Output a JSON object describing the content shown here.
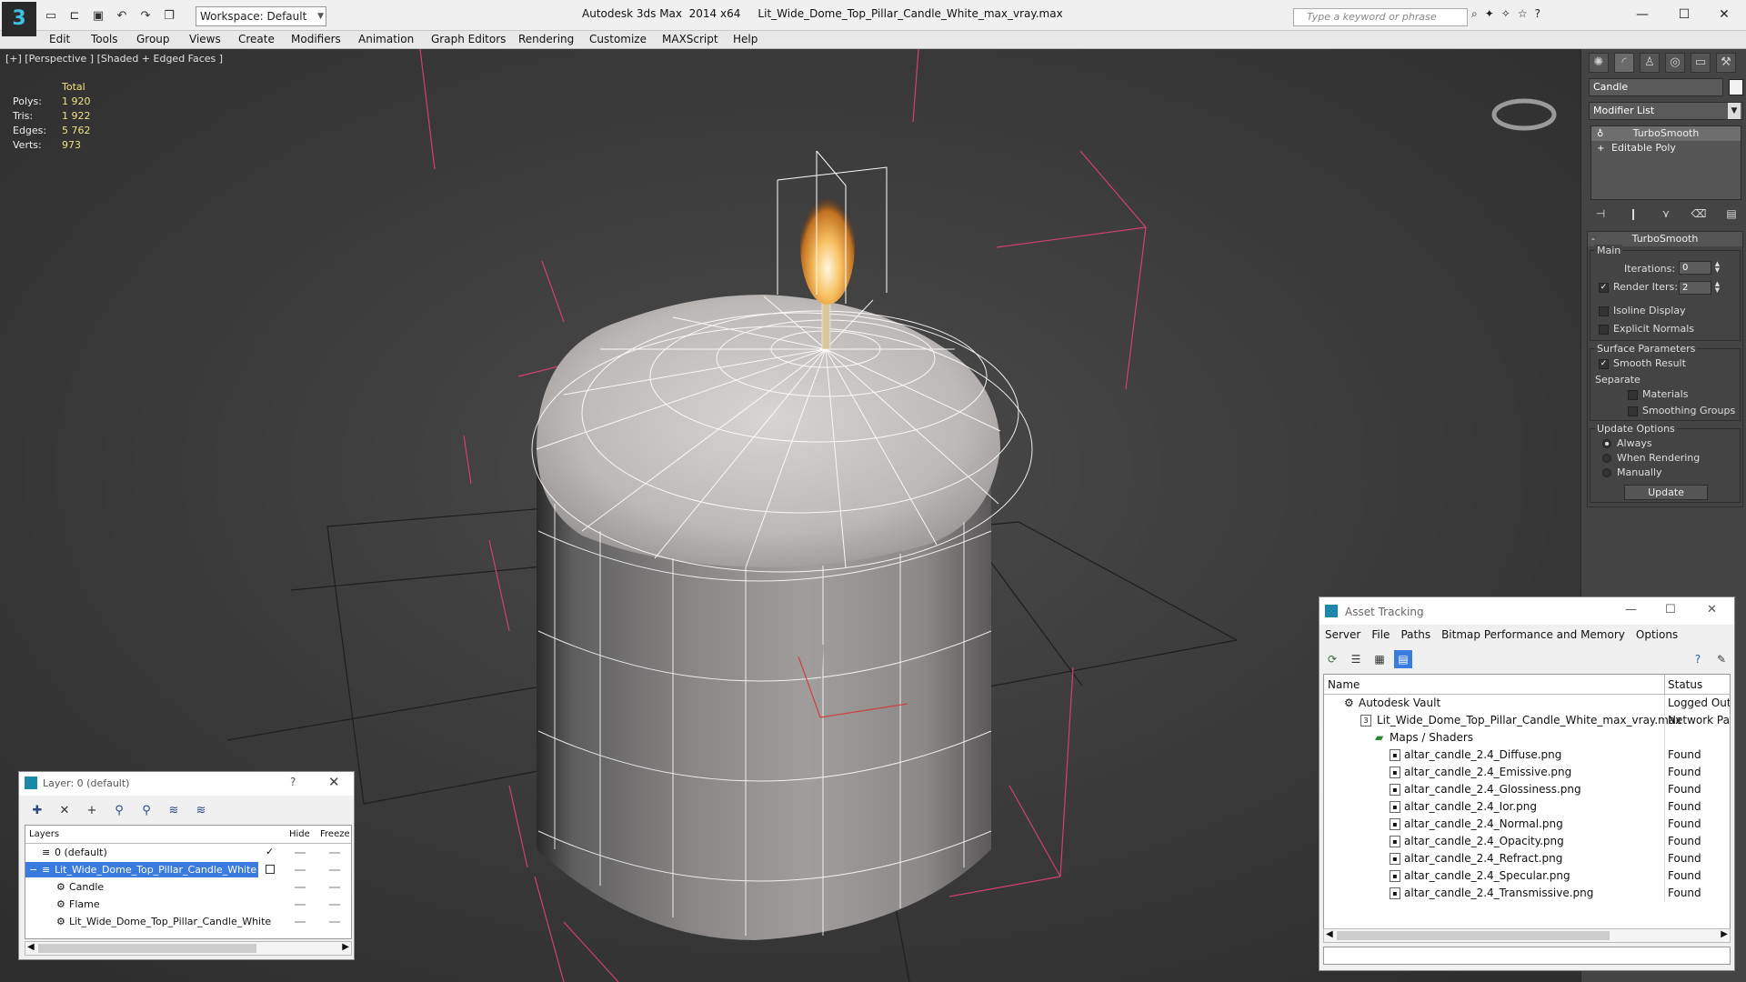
{
  "app": {
    "title": "Autodesk 3ds Max  2014 x64     Lit_Wide_Dome_Top_Pillar_Candle_White_max_vray.max",
    "workspace": "Workspace: Default",
    "search_placeholder": "Type a keyword or phrase"
  },
  "menu": [
    "Edit",
    "Tools",
    "Group",
    "Views",
    "Create",
    "Modifiers",
    "Animation",
    "Graph Editors",
    "Rendering",
    "Customize",
    "MAXScript",
    "Help"
  ],
  "viewport": {
    "label": "[+] [Perspective ] [Shaded + Edged Faces ]",
    "stats": {
      "header": "Total",
      "rows": [
        {
          "k": "Polys:",
          "v": "1 920"
        },
        {
          "k": "Tris:",
          "v": "1 922"
        },
        {
          "k": "Edges:",
          "v": "5 762"
        },
        {
          "k": "Verts:",
          "v": "973"
        }
      ]
    }
  },
  "command_panel": {
    "object_name": "Candle",
    "modifier_list": "Modifier List",
    "stack": [
      "TurboSmooth",
      "Editable Poly"
    ],
    "rollout_title": "TurboSmooth",
    "main_label": "Main",
    "iterations_label": "Iterations:",
    "iterations_value": "0",
    "render_iters_label": "Render Iters:",
    "render_iters_value": "2",
    "isoline_label": "Isoline Display",
    "explicit_normals_label": "Explicit Normals",
    "surface_params_label": "Surface Parameters",
    "smooth_result_label": "Smooth Result",
    "separate_label": "Separate",
    "materials_label": "Materials",
    "smoothing_groups_label": "Smoothing Groups",
    "update_options_label": "Update Options",
    "always_label": "Always",
    "when_rendering_label": "When Rendering",
    "manually_label": "Manually",
    "update_button": "Update"
  },
  "layer_dialog": {
    "title": "Layer: 0 (default)",
    "help": "?",
    "col_layers": "Layers",
    "col_hide": "Hide",
    "col_freeze": "Freeze",
    "rows": [
      {
        "name": "0 (default)"
      },
      {
        "name": "Lit_Wide_Dome_Top_Pillar_Candle_White"
      },
      {
        "name": "Candle"
      },
      {
        "name": "Flame"
      },
      {
        "name": "Lit_Wide_Dome_Top_Pillar_Candle_White"
      }
    ]
  },
  "asset_dialog": {
    "title": "Asset Tracking",
    "menu": [
      "Server",
      "File",
      "Paths",
      "Bitmap Performance and Memory",
      "Options"
    ],
    "col_name": "Name",
    "col_status": "Status",
    "rows": [
      {
        "name": "Autodesk Vault",
        "status": "Logged Out"
      },
      {
        "name": "Lit_Wide_Dome_Top_Pillar_Candle_White_max_vray.max",
        "status": "Network Path"
      },
      {
        "name": "Maps / Shaders",
        "status": ""
      },
      {
        "name": "altar_candle_2.4_Diffuse.png",
        "status": "Found"
      },
      {
        "name": "altar_candle_2.4_Emissive.png",
        "status": "Found"
      },
      {
        "name": "altar_candle_2.4_Glossiness.png",
        "status": "Found"
      },
      {
        "name": "altar_candle_2.4_Ior.png",
        "status": "Found"
      },
      {
        "name": "altar_candle_2.4_Normal.png",
        "status": "Found"
      },
      {
        "name": "altar_candle_2.4_Opacity.png",
        "status": "Found"
      },
      {
        "name": "altar_candle_2.4_Refract.png",
        "status": "Found"
      },
      {
        "name": "altar_candle_2.4_Specular.png",
        "status": "Found"
      },
      {
        "name": "altar_candle_2.4_Transmissive.png",
        "status": "Found"
      }
    ]
  }
}
